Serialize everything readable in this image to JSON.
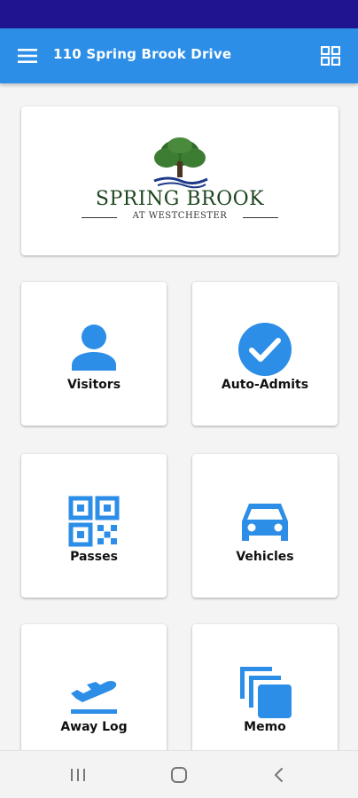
{
  "header": {
    "title": "110 Spring Brook Drive",
    "menu_icon": "menu-icon",
    "grid_icon": "grid-view-icon"
  },
  "logo": {
    "name": "SPRING BROOK",
    "subtitle": "AT WESTCHESTER"
  },
  "tiles": [
    {
      "label": "Visitors",
      "icon": "person-icon"
    },
    {
      "label": "Auto-Admits",
      "icon": "check-circle-icon"
    },
    {
      "label": "Passes",
      "icon": "qr-code-icon"
    },
    {
      "label": "Vehicles",
      "icon": "car-icon"
    },
    {
      "label": "Away Log",
      "icon": "flight-takeoff-icon"
    },
    {
      "label": "Memo",
      "icon": "memo-stack-icon"
    }
  ],
  "colors": {
    "status_bar": "#1f1590",
    "app_bar": "#2c8ee7",
    "icon_blue": "#2c8ee7",
    "logo_green": "#1e4620"
  },
  "nav": {
    "recents_icon": "recent-apps-icon",
    "home_icon": "home-icon",
    "back_icon": "back-icon"
  }
}
